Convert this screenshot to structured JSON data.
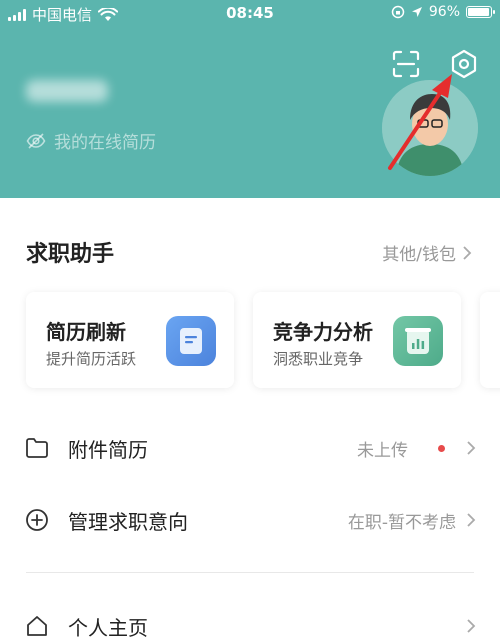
{
  "status_bar": {
    "carrier": "中国电信",
    "time": "08:45",
    "battery": "96%",
    "battery_level": 0.96
  },
  "header": {
    "resume_link": "我的在线简历",
    "scan_icon": "scan-icon",
    "settings_icon": "settings-gear-icon",
    "bg_color": "#5bb5ae"
  },
  "assistant": {
    "title": "求职助手",
    "more": "其他/钱包",
    "cards": [
      {
        "title": "简历刷新",
        "sub": "提升简历活跃",
        "icon": "document-icon"
      },
      {
        "title": "竞争力分析",
        "sub": "洞悉职业竞争",
        "icon": "chart-icon"
      }
    ]
  },
  "list": [
    {
      "label": "附件简历",
      "value": "未上传",
      "icon": "folder-icon",
      "has_dot": true
    },
    {
      "label": "管理求职意向",
      "value": "在职-暂不考虑",
      "icon": "plus-circle-icon"
    },
    {
      "label": "个人主页",
      "value": "",
      "icon": "home-icon"
    }
  ],
  "colors": {
    "accent": "#5bb5ae",
    "annotation_arrow": "#e52d2d",
    "dot": "#e74b4b"
  }
}
